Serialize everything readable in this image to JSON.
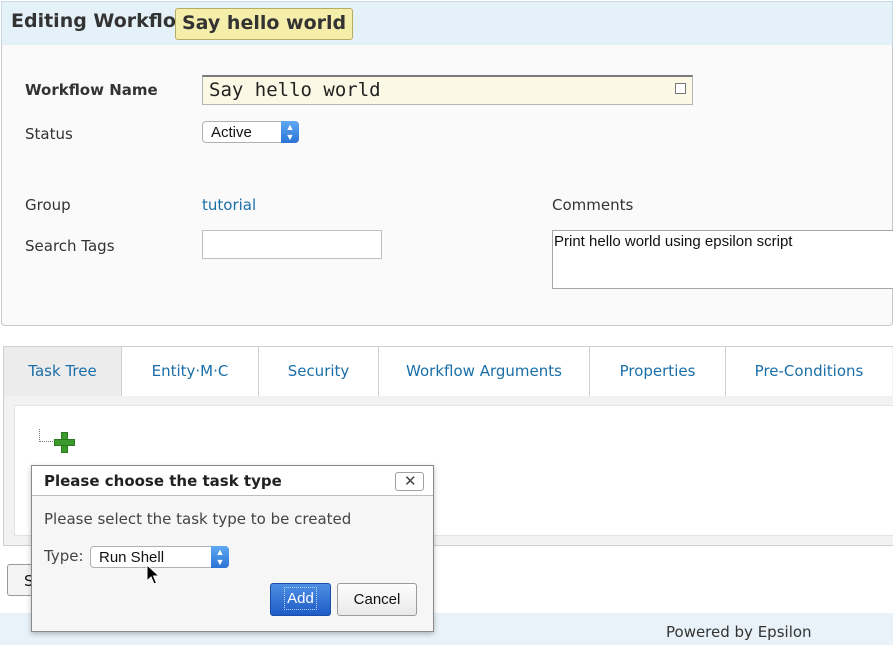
{
  "header": {
    "title": "Editing Workflow",
    "workflow_name_badge": "Say hello world"
  },
  "form": {
    "workflow_name_label": "Workflow Name",
    "workflow_name_value": "Say hello world",
    "status_label": "Status",
    "status_value": "Active",
    "group_label": "Group",
    "group_value": "tutorial",
    "search_tags_label": "Search Tags",
    "search_tags_value": "",
    "comments_label": "Comments",
    "comments_value": "Print hello world using epsilon script"
  },
  "tabs": [
    {
      "label": "Task Tree",
      "active": true
    },
    {
      "label": "Entity·M·C",
      "active": false
    },
    {
      "label": "Security",
      "active": false
    },
    {
      "label": "Workflow Arguments",
      "active": false
    },
    {
      "label": "Properties",
      "active": false
    },
    {
      "label": "Pre-Conditions",
      "active": false
    }
  ],
  "task_tree": {
    "add_icon": "plus-icon"
  },
  "behind_button_label": "S",
  "dialog": {
    "title": "Please choose the task type",
    "message": "Please select the task type to be created",
    "type_label": "Type:",
    "type_value": "Run Shell",
    "add_label": "Add",
    "cancel_label": "Cancel",
    "close_icon": "close-icon"
  },
  "footer": {
    "text": "Powered by Epsilon"
  },
  "colors": {
    "header_bg": "#e4f1f9",
    "badge_bg": "#f5eeab",
    "link": "#1a6ea8",
    "primary_button": "#2b6bd6",
    "add_icon": "#3c9a2c"
  }
}
